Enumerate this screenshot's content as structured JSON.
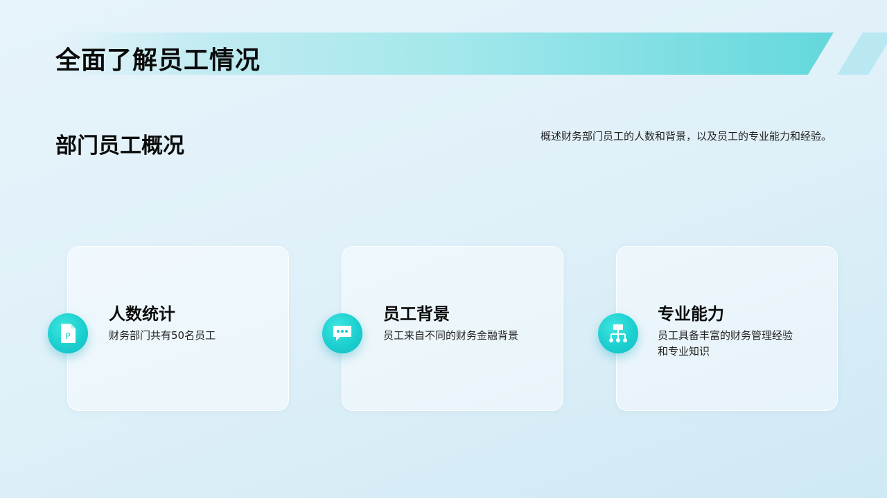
{
  "header": {
    "title": "全面了解员工情况"
  },
  "section": {
    "title": "部门员工概况",
    "description": "概述财务部门员工的人数和背景，以及员工的专业能力和经验。"
  },
  "cards": [
    {
      "icon": "ppt-file-icon",
      "title": "人数统计",
      "text": "财务部门共有50名员工"
    },
    {
      "icon": "chat-bubble-icon",
      "title": "员工背景",
      "text": "员工来自不同的财务金融背景"
    },
    {
      "icon": "org-chart-icon",
      "title": "专业能力",
      "text": "员工具备丰富的财务管理经验和专业知识"
    }
  ],
  "colors": {
    "accent": "#1ccfcf",
    "banner_end": "#63d8dc",
    "text": "#0b0b0b"
  }
}
